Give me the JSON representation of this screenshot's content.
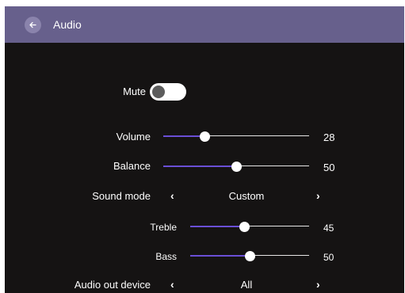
{
  "header": {
    "title": "Audio",
    "back_icon": "arrow-left-icon"
  },
  "colors": {
    "header_bg": "#67608c",
    "page_bg": "#151313",
    "accent": "#6a4fd6"
  },
  "mute": {
    "label": "Mute",
    "enabled": false
  },
  "volume": {
    "label": "Volume",
    "value": "28",
    "fraction": 0.28
  },
  "balance": {
    "label": "Balance",
    "value": "50",
    "fraction": 0.5
  },
  "sound_mode": {
    "label": "Sound mode",
    "value": "Custom",
    "prev_icon": "chevron-left-icon",
    "next_icon": "chevron-right-icon"
  },
  "treble": {
    "label": "Treble",
    "value": "45",
    "fraction": 0.45
  },
  "bass": {
    "label": "Bass",
    "value": "50",
    "fraction": 0.5
  },
  "audio_out": {
    "label": "Audio out device",
    "value": "All",
    "prev_icon": "chevron-left-icon",
    "next_icon": "chevron-right-icon"
  }
}
